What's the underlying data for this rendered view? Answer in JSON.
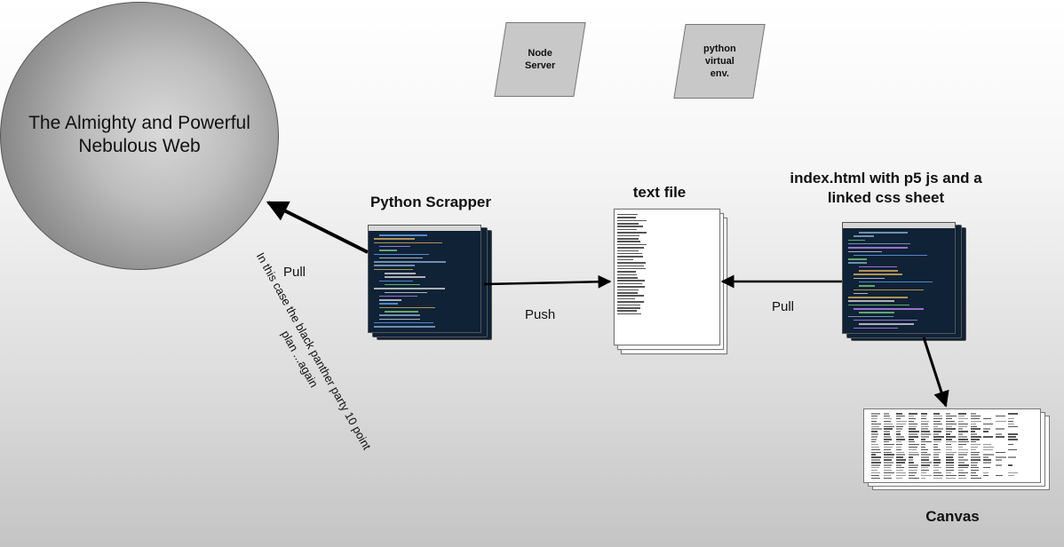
{
  "nodes": {
    "web": "The Almighty and Powerful Nebulous Web",
    "node_server": "Node\nServer",
    "python_env": "python\nvirtual\nenv.",
    "python_scrapper": "Python Scrapper",
    "text_file": "text file",
    "index_html": "index.html with p5 js and a linked css sheet",
    "canvas": "Canvas"
  },
  "edge_labels": {
    "pull_left": "Pull",
    "push": "Push",
    "pull_right": "Pull"
  },
  "annotation": "In this case the black panther party 10 point plan ...again"
}
